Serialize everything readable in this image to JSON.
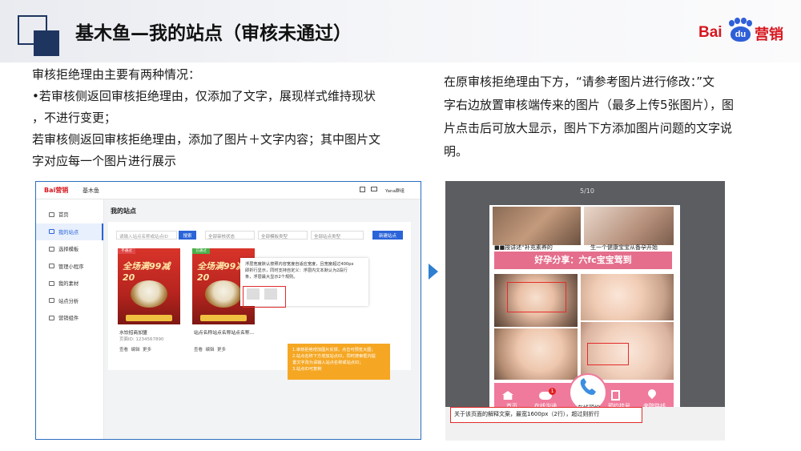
{
  "header": {
    "title": "基木鱼—我的站点（审核未通过）"
  },
  "logo": {
    "bai": "Bai",
    "du": "du",
    "ying": "营销"
  },
  "left_text": {
    "line1": "审核拒绝理由主要有两种情况：",
    "line2": "•若审核侧返回审核拒绝理由，仅添加了文字，展现样式维持现状",
    "line3": "，不进行变更；",
    "line4": "若审核侧返回审核拒绝理由，添加了图片＋文字内容；其中图片文",
    "line5": "字对应每一个图片进行展示"
  },
  "right_text": {
    "line1": "在原审核拒绝理由下方，“请参考图片进行修改：”文",
    "line2": "字右边放置审核端传来的图片（最多上传5张图片），图",
    "line3": "片点击后可放大显示，图片下方添加图片问题的文字说",
    "line4": "明。"
  },
  "shot1": {
    "brand": "Bai营销",
    "product": "基木鱼",
    "user": "Yana群组",
    "page_title": "我的站点",
    "sidebar": [
      {
        "label": "首页",
        "active": false
      },
      {
        "label": "我的站点",
        "active": true
      },
      {
        "label": "选择模板",
        "active": false
      },
      {
        "label": "管理小程序",
        "active": false
      },
      {
        "label": "我的素材",
        "active": false
      },
      {
        "label": "站点分析",
        "active": false
      },
      {
        "label": "营销组件",
        "active": false
      }
    ],
    "search_placeholder": "请输入站点名称或站点ID",
    "search_button": "搜索",
    "filters": [
      "全部审核状态",
      "全部模板类型",
      "全部站点类型"
    ],
    "new_site_button": "新建站点",
    "card1": {
      "tag": "不通过",
      "promo": "全场满99减20",
      "name": "水饺招商加盟",
      "id": "页面ID: 1234567890",
      "view": "查看",
      "edit": "编辑",
      "more": "更多"
    },
    "card2": {
      "tag": "已通过",
      "promo": "全场满99减20",
      "name": "站点名称站点名称站点名称...",
      "view": "查看",
      "edit": "编辑",
      "more": "更多"
    },
    "popup": {
      "line1": "浮层宽度默认按照内容宽度自适应宽度，且宽度超过400px",
      "line2": "即折行显示，同时支持自定义：浮层内文本默认为2段行",
      "line3": "条，浮层最大显示2个规则。"
    },
    "orange_note": {
      "line1": "1.审核拒绝增加图片反馈，点击可预览大图；",
      "line2": "2.站点名称下方增加站点ID，同时搜索框内提",
      "line3": "置文字改为请输入站点名称或站点ID；",
      "line4": "3.站点ID可复制"
    }
  },
  "shot2": {
    "counter": "5/10",
    "cap1": "■■按讲述“补充素养的",
    "cap2": "生一个健康宝宝从备孕开始",
    "banner": "好孕分享：六fc宝宝驾到",
    "nav": [
      "首页",
      "在线沟通",
      "在线预约",
      "预约挂号",
      "来院路线"
    ],
    "badge": "1",
    "caption": "关于该页面的解释文案，最宽1600px（2行），超过则折行"
  },
  "colors": {
    "navy": "#1e3560",
    "baidu_red": "#d7171f",
    "baidu_blue": "#2f5fd8",
    "arrow": "#2f7fd1",
    "orange": "#f5a724",
    "pink": "#e56e8c"
  }
}
